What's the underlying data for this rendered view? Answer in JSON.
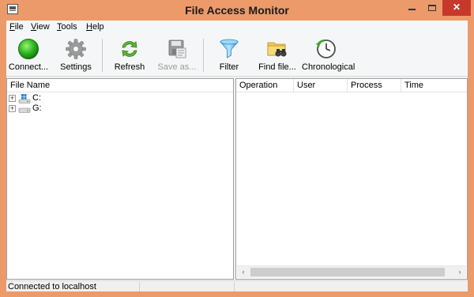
{
  "window": {
    "title": "File Access Monitor",
    "close_glyph": "✕",
    "frame_color": "#ED9A6A",
    "close_color": "#C7382B"
  },
  "menu": [
    {
      "label": "File",
      "accel": "F",
      "rest": "ile"
    },
    {
      "label": "View",
      "accel": "V",
      "rest": "iew"
    },
    {
      "label": "Tools",
      "accel": "T",
      "rest": "ools"
    },
    {
      "label": "Help",
      "accel": "H",
      "rest": "elp"
    }
  ],
  "toolbar": {
    "connect": {
      "label": "Connect...",
      "icon": "green-circle-icon"
    },
    "settings": {
      "label": "Settings",
      "icon": "gear-icon"
    },
    "refresh": {
      "label": "Refresh",
      "icon": "refresh-arrows-icon"
    },
    "save_as": {
      "label": "Save as...",
      "icon": "floppy-disk-icon",
      "disabled": true
    },
    "filter": {
      "label": "Filter",
      "icon": "funnel-icon"
    },
    "find_file": {
      "label": "Find file...",
      "icon": "folder-binoculars-icon"
    },
    "chronological": {
      "label": "Chronological",
      "icon": "clock-icon"
    }
  },
  "left_pane": {
    "header": "File Name",
    "drives": [
      {
        "label": "C:",
        "icon": "system-drive-icon",
        "expander": "+"
      },
      {
        "label": "G:",
        "icon": "drive-icon",
        "expander": "+"
      }
    ]
  },
  "right_pane": {
    "columns": [
      "Operation",
      "User",
      "Process",
      "Time"
    ]
  },
  "scrollbar": {
    "left_arrow": "‹",
    "right_arrow": "›"
  },
  "status": {
    "text": "Connected to localhost"
  }
}
